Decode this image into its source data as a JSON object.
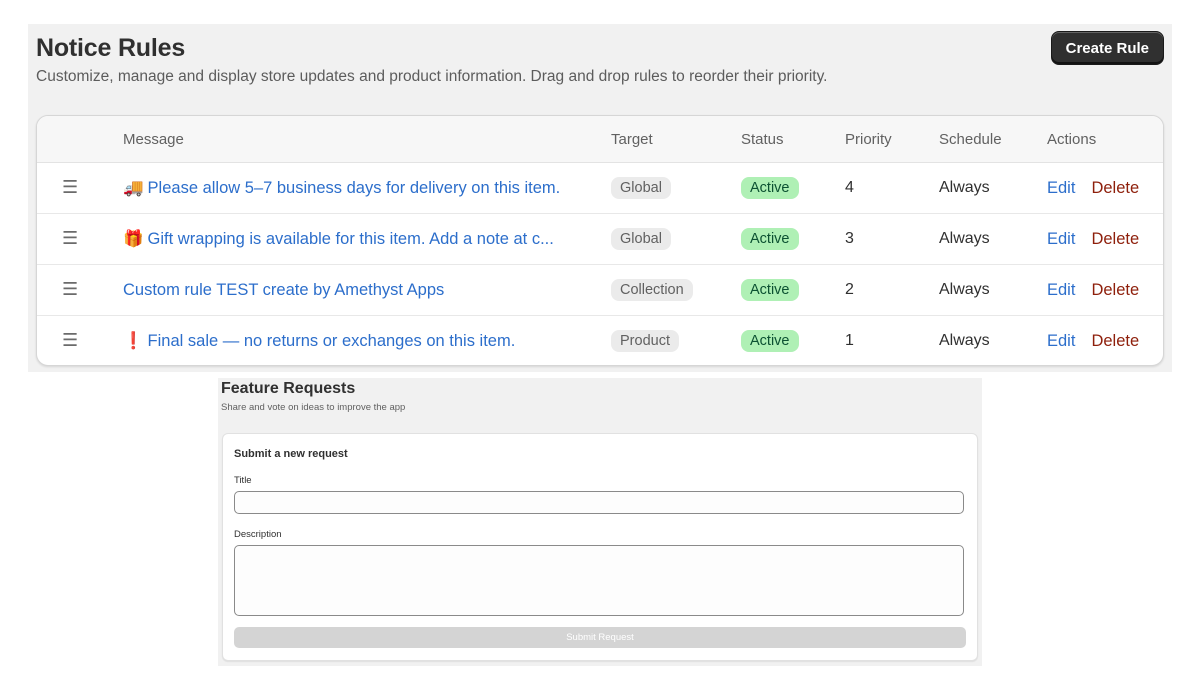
{
  "notice_rules": {
    "title": "Notice Rules",
    "subtitle": "Customize, manage and display store updates and product information. Drag and drop rules to reorder their priority.",
    "create_button_label": "Create Rule",
    "columns": {
      "message": "Message",
      "target": "Target",
      "status": "Status",
      "priority": "Priority",
      "schedule": "Schedule",
      "actions": "Actions"
    },
    "rows": [
      {
        "emoji": "🚚",
        "message": "Please allow 5–7 business days for delivery on this item.",
        "target": "Global",
        "status": "Active",
        "priority": "4",
        "schedule": "Always",
        "edit_label": "Edit",
        "delete_label": "Delete"
      },
      {
        "emoji": "🎁",
        "message": "Gift wrapping is available for this item. Add a note at c...",
        "target": "Global",
        "status": "Active",
        "priority": "3",
        "schedule": "Always",
        "edit_label": "Edit",
        "delete_label": "Delete"
      },
      {
        "emoji": "",
        "message": "Custom rule TEST create by Amethyst Apps",
        "target": "Collection",
        "status": "Active",
        "priority": "2",
        "schedule": "Always",
        "edit_label": "Edit",
        "delete_label": "Delete"
      },
      {
        "emoji": "❗",
        "message": "Final sale — no returns or exchanges on this item.",
        "target": "Product",
        "status": "Active",
        "priority": "1",
        "schedule": "Always",
        "edit_label": "Edit",
        "delete_label": "Delete"
      }
    ],
    "icons": {
      "drag_handle": "drag-handle-icon"
    }
  },
  "feature_requests": {
    "title": "Feature Requests",
    "subtitle": "Share and vote on ideas to improve the app",
    "form": {
      "heading": "Submit a new request",
      "title_label": "Title",
      "title_value": "",
      "description_label": "Description",
      "description_value": "",
      "submit_label": "Submit Request"
    }
  },
  "colors": {
    "link_blue": "#2c6ecb",
    "delete_red": "#8e1f0b",
    "active_badge_bg": "#aff0b5",
    "active_badge_text": "#0c5132",
    "primary_button_bg": "#303030",
    "panel_bg": "#f1f1f1"
  }
}
